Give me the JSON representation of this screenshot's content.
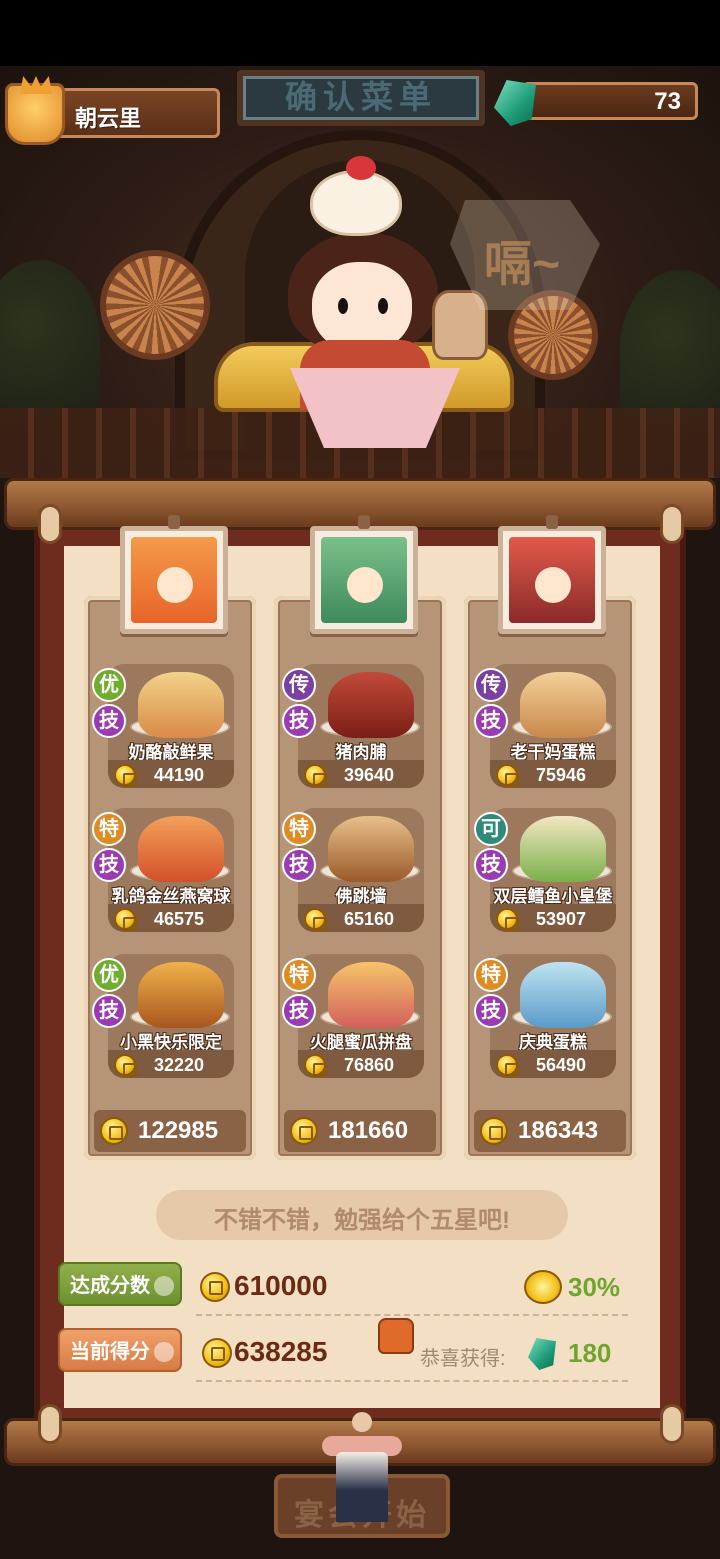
{
  "header": {
    "user_name": "朝云里",
    "title": "确认菜单",
    "gem_count": "73"
  },
  "speech_bubble": "嗝~",
  "columns": [
    {
      "total": "122985",
      "dishes": [
        {
          "rank": "优",
          "skill": "技",
          "name": "奶酪敲鲜果",
          "price": "44190"
        },
        {
          "rank": "特",
          "skill": "技",
          "name": "乳鸽金丝燕窝球",
          "price": "46575"
        },
        {
          "rank": "优",
          "skill": "技",
          "name": "小黑快乐限定",
          "price": "32220"
        }
      ]
    },
    {
      "total": "181660",
      "dishes": [
        {
          "rank": "传",
          "skill": "技",
          "name": "猪肉脯",
          "price": "39640"
        },
        {
          "rank": "特",
          "skill": "技",
          "name": "佛跳墙",
          "price": "65160"
        },
        {
          "rank": "特",
          "skill": "技",
          "name": "火腿蜜瓜拼盘",
          "price": "76860"
        }
      ]
    },
    {
      "total": "186343",
      "dishes": [
        {
          "rank": "传",
          "skill": "技",
          "name": "老干妈蛋糕",
          "price": "75946"
        },
        {
          "rank": "可",
          "skill": "技",
          "name": "双层鳕鱼小皇堡",
          "price": "53907"
        },
        {
          "rank": "特",
          "skill": "技",
          "name": "庆典蛋糕",
          "price": "56490"
        }
      ]
    }
  ],
  "comment": "不错不错，勉强给个五星吧!",
  "score": {
    "target_label": "达成分数",
    "target_value": "610000",
    "bonus_percent": "30%",
    "current_label": "当前得分",
    "current_value": "638285",
    "reward_label": "恭喜获得:",
    "reward_value": "180"
  },
  "start_button": "宴会开始",
  "colors": {
    "accent_green": "#6fa52c",
    "score_brown": "#6a2a14",
    "skill_purple": "#9b3bb0"
  }
}
